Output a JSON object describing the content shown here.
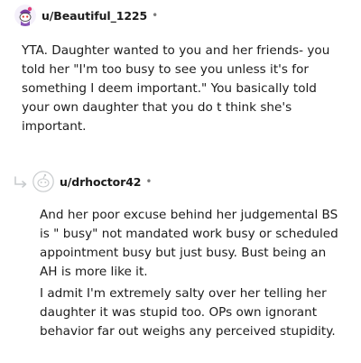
{
  "comments": [
    {
      "username": "u/Beautiful_1225",
      "separator": "•",
      "avatar_icon": "snoo-avatar-purple-icon",
      "paragraphs": [
        "YTA. Daughter wanted to you and her friends- you told her \"I'm too busy to see you unless it's for something I deem important.\" You basically told your own daughter that you do t think she's important."
      ]
    },
    {
      "username": "u/drhoctor42",
      "separator": "•",
      "avatar_icon": "default-avatar-icon",
      "reply_icon": "reply-arrow-icon",
      "paragraphs": [
        "And her poor excuse behind her judgemental BS is \" busy\" not mandated work busy or scheduled appointment busy but just busy. Bust being an AH is more like it.",
        "I admit I'm extremely salty over her telling her daughter it was stupid too. OPs own ignorant behavior far out weighs any perceived stupidity."
      ]
    }
  ]
}
